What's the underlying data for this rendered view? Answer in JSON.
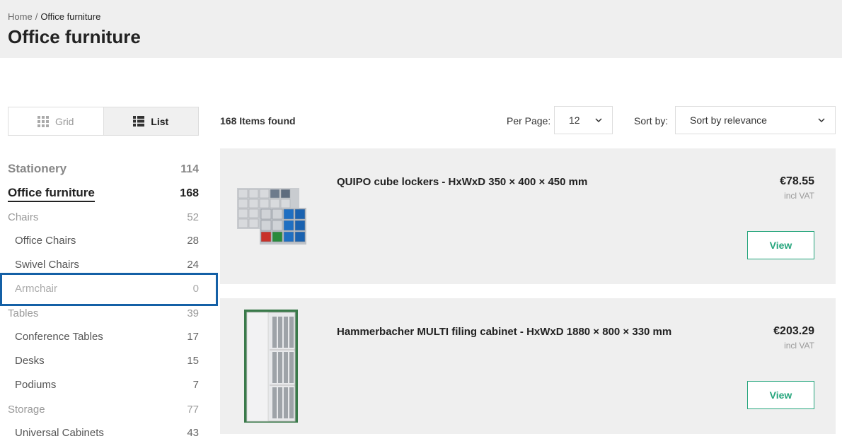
{
  "breadcrumb": {
    "home": "Home",
    "separator": "/",
    "current": "Office furniture"
  },
  "page_title": "Office furniture",
  "view_toggle": {
    "grid": "Grid",
    "list": "List",
    "selected": "List"
  },
  "categories": [
    {
      "label": "Stationery",
      "count": "114"
    },
    {
      "label": "Office furniture",
      "count": "168"
    },
    {
      "label": "Chairs",
      "count": "52"
    },
    {
      "label": "Office Chairs",
      "count": "28"
    },
    {
      "label": "Swivel Chairs",
      "count": "24"
    },
    {
      "label": "Armchair",
      "count": "0"
    },
    {
      "label": "Tables",
      "count": "39"
    },
    {
      "label": "Conference Tables",
      "count": "17"
    },
    {
      "label": "Desks",
      "count": "15"
    },
    {
      "label": "Podiums",
      "count": "7"
    },
    {
      "label": "Storage",
      "count": "77"
    },
    {
      "label": "Universal Cabinets",
      "count": "43"
    }
  ],
  "toolbar": {
    "items_found": "168 Items found",
    "per_page_label": "Per Page:",
    "per_page_value": "12",
    "sort_label": "Sort by:",
    "sort_value": "Sort by relevance"
  },
  "products": [
    {
      "name": "QUIPO cube lockers - HxWxD 350 × 400 × 450 mm",
      "price": "€78.55",
      "vat": "incl VAT",
      "button": "View"
    },
    {
      "name": "Hammerbacher MULTI filing cabinet - HxWxD 1880 × 800 × 330 mm",
      "price": "€203.29",
      "vat": "incl VAT",
      "button": "View"
    }
  ],
  "colors": {
    "accent": "#25a57c",
    "focus": "#1460a6",
    "header_bg": "#efefef"
  }
}
